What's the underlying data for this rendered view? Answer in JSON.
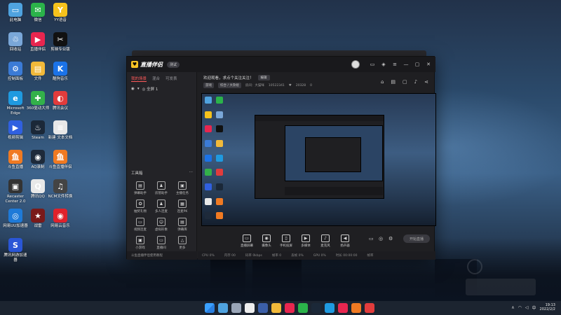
{
  "desktop": {
    "icons": [
      {
        "label": "此电脑",
        "color": "#4fa3e0",
        "glyph": "▭"
      },
      {
        "label": "微信",
        "color": "#2bb34a",
        "glyph": "✉"
      },
      {
        "label": "YY语音",
        "color": "#f6c21c",
        "glyph": "Y"
      },
      {
        "label": "回收站",
        "color": "#7aa7d8",
        "glyph": "♲"
      },
      {
        "label": "直播伴侣",
        "color": "#e8264f",
        "glyph": "▶"
      },
      {
        "label": "剪映专业版",
        "color": "#111111",
        "glyph": "✂"
      },
      {
        "label": "控制面板",
        "color": "#3b7bd6",
        "glyph": "⚙"
      },
      {
        "label": "文件",
        "color": "#f1b93a",
        "glyph": "▤"
      },
      {
        "label": "酷狗音乐",
        "color": "#1b73e8",
        "glyph": "K"
      },
      {
        "label": "Microsoft Edge",
        "color": "#1f9ae0",
        "glyph": "e"
      },
      {
        "label": "360驱动大师",
        "color": "#33b14a",
        "glyph": "✚"
      },
      {
        "label": "腾讯会议",
        "color": "#e23c3c",
        "glyph": "◐"
      },
      {
        "label": "视频剪辑",
        "color": "#3060e0",
        "glyph": "▶"
      },
      {
        "label": "Steam",
        "color": "#1b2838",
        "glyph": "♨"
      },
      {
        "label": "新建 文本文档",
        "color": "#e8e8e8",
        "glyph": "≡"
      },
      {
        "label": "斗鱼直播",
        "color": "#f07a22",
        "glyph": "鱼"
      },
      {
        "label": "AQ录制",
        "color": "#1e2a3a",
        "glyph": "◉"
      },
      {
        "label": "斗鱼直播伴侣",
        "color": "#f07a22",
        "glyph": "鱼"
      },
      {
        "label": "Recaster Center 2.0",
        "color": "#333333",
        "glyph": "▣"
      },
      {
        "label": "腾讯QQ",
        "color": "#e8e8e8",
        "glyph": "Q"
      },
      {
        "label": "NCM文件转换",
        "color": "#444444",
        "glyph": "♫"
      },
      {
        "label": "网易UU加速器",
        "color": "#1e7ad8",
        "glyph": "◎"
      },
      {
        "label": "战雷",
        "color": "#7a1a1a",
        "glyph": "★"
      },
      {
        "label": "网易云音乐",
        "color": "#e0222b",
        "glyph": "◉"
      },
      {
        "label": "腾讯网游加速器",
        "color": "#2a56d6",
        "glyph": "S"
      }
    ]
  },
  "app": {
    "name": "直播伴侣",
    "version_badge": "测试",
    "left_tabs": [
      "我的场景",
      "混合",
      "可发表"
    ],
    "scene_label": "◎ 全屏 1",
    "tools_title": "工具箱",
    "tools_more": "⋯",
    "tools": [
      {
        "label": "弹幕助手",
        "glyph": "▤"
      },
      {
        "label": "房管助手",
        "glyph": "♟"
      },
      {
        "label": "主播任务",
        "glyph": "▣"
      },
      {
        "label": "抽奖礼物",
        "glyph": "✪"
      },
      {
        "label": "多人连麦",
        "glyph": "♟"
      },
      {
        "label": "连麦PK",
        "glyph": "▦"
      },
      {
        "label": "视频连麦",
        "glyph": "▭"
      },
      {
        "label": "虚拟形象",
        "glyph": "☺"
      },
      {
        "label": "弹幕库",
        "glyph": "▤"
      },
      {
        "label": "小游戏",
        "glyph": "▣"
      },
      {
        "label": "直播间",
        "glyph": "▭"
      },
      {
        "label": "更多",
        "glyph": "△"
      }
    ],
    "notice": "斗鱼直播伴侣使用教程",
    "room_title": "欢迎观看，求点个关注关注！",
    "edit_label": "编辑",
    "meta": {
      "tag1": "游戏",
      "tag2": "综合 / 大杂烩",
      "room_id_label": "房间：大猫咪",
      "room_id": "10522341",
      "fans_icon": "♥",
      "fans": "20328",
      "online": "0"
    },
    "bottom_actions": [
      {
        "label": "直播屏幕",
        "glyph": "▭"
      },
      {
        "label": "摄像头",
        "glyph": "◉"
      },
      {
        "label": "手机投屏",
        "glyph": "▯"
      },
      {
        "label": "多媒体",
        "glyph": "▶"
      },
      {
        "label": "麦克风",
        "glyph": "♪"
      },
      {
        "label": "扬声器",
        "glyph": "◀"
      }
    ],
    "start_label": "开始直播",
    "status": [
      "CPU 0%",
      "内存 00",
      "码率 0kbps",
      "帧率 0",
      "丢帧 0%",
      "GPU 0%",
      "时长 00:00:00",
      "帧率"
    ]
  },
  "taskbar": {
    "time": "19:13",
    "date": "2022/2/2",
    "tray_lang": "中",
    "tray_caret": "∧",
    "apps": [
      "#4fa3e0",
      "#9aa6b8",
      "#eeeeee",
      "#3b5fa8",
      "#f1b93a",
      "#e8264f",
      "#2bb34a",
      "#1b2838",
      "#1f9ae0",
      "#e8264f",
      "#f07a22",
      "#e23c3c"
    ]
  }
}
